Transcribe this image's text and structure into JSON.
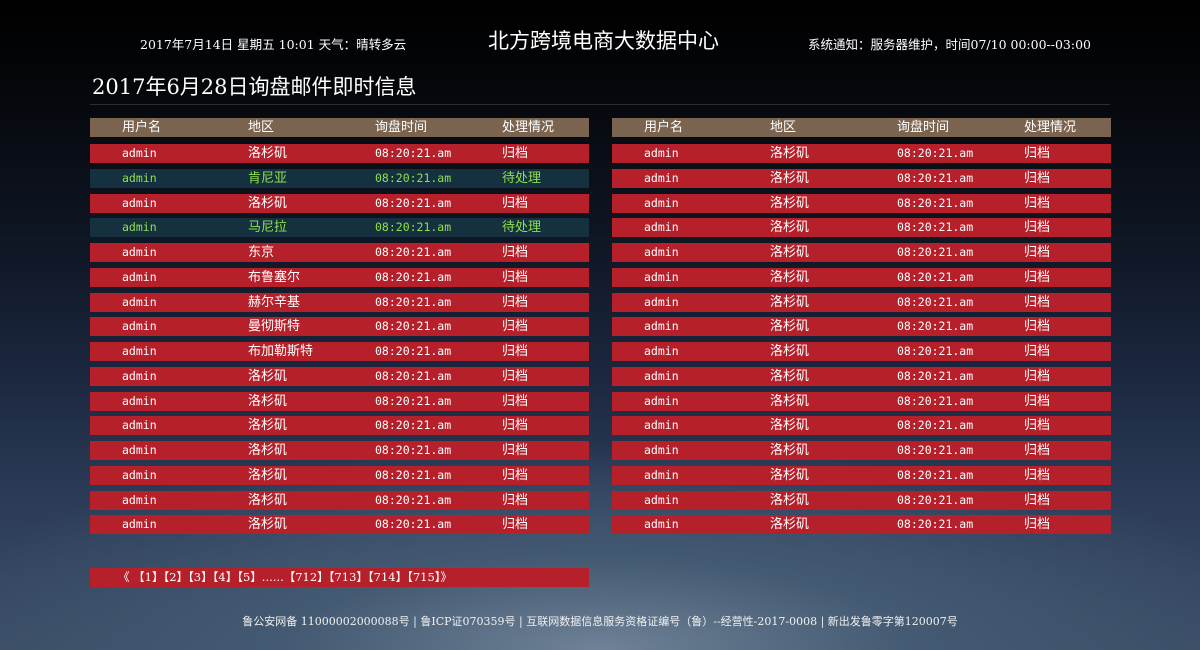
{
  "header": {
    "date_weather": "2017年7月14日  星期五  10:01  天气：晴转多云",
    "site_title": "北方跨境电商大数据中心",
    "notice": "系统通知：服务器维护，时间07/10 00:00--03:00"
  },
  "section_title": "2017年6月28日询盘邮件即时信息",
  "columns": [
    "用户名",
    "地区",
    "询盘时间",
    "处理情况"
  ],
  "left_rows": [
    {
      "user": "admin",
      "region": "洛杉矶",
      "time": "08:20:21.am",
      "status": "归档",
      "kind": "archived"
    },
    {
      "user": "admin",
      "region": "肯尼亚",
      "time": "08:20:21.am",
      "status": "待处理",
      "kind": "pending"
    },
    {
      "user": "admin",
      "region": "洛杉矶",
      "time": "08:20:21.am",
      "status": "归档",
      "kind": "archived"
    },
    {
      "user": "admin",
      "region": "马尼拉",
      "time": "08:20:21.am",
      "status": "待处理",
      "kind": "pending"
    },
    {
      "user": "admin",
      "region": "东京",
      "time": "08:20:21.am",
      "status": "归档",
      "kind": "archived"
    },
    {
      "user": "admin",
      "region": "布鲁塞尔",
      "time": "08:20:21.am",
      "status": "归档",
      "kind": "archived"
    },
    {
      "user": "admin",
      "region": "赫尔辛基",
      "time": "08:20:21.am",
      "status": "归档",
      "kind": "archived"
    },
    {
      "user": "admin",
      "region": "曼彻斯特",
      "time": "08:20:21.am",
      "status": "归档",
      "kind": "archived"
    },
    {
      "user": "admin",
      "region": "布加勒斯特",
      "time": "08:20:21.am",
      "status": "归档",
      "kind": "archived"
    },
    {
      "user": "admin",
      "region": "洛杉矶",
      "time": "08:20:21.am",
      "status": "归档",
      "kind": "archived"
    },
    {
      "user": "admin",
      "region": "洛杉矶",
      "time": "08:20:21.am",
      "status": "归档",
      "kind": "archived"
    },
    {
      "user": "admin",
      "region": "洛杉矶",
      "time": "08:20:21.am",
      "status": "归档",
      "kind": "archived"
    },
    {
      "user": "admin",
      "region": "洛杉矶",
      "time": "08:20:21.am",
      "status": "归档",
      "kind": "archived"
    },
    {
      "user": "admin",
      "region": "洛杉矶",
      "time": "08:20:21.am",
      "status": "归档",
      "kind": "archived"
    },
    {
      "user": "admin",
      "region": "洛杉矶",
      "time": "08:20:21.am",
      "status": "归档",
      "kind": "archived"
    },
    {
      "user": "admin",
      "region": "洛杉矶",
      "time": "08:20:21.am",
      "status": "归档",
      "kind": "archived"
    }
  ],
  "right_rows": [
    {
      "user": "admin",
      "region": "洛杉矶",
      "time": "08:20:21.am",
      "status": "归档",
      "kind": "archived"
    },
    {
      "user": "admin",
      "region": "洛杉矶",
      "time": "08:20:21.am",
      "status": "归档",
      "kind": "archived"
    },
    {
      "user": "admin",
      "region": "洛杉矶",
      "time": "08:20:21.am",
      "status": "归档",
      "kind": "archived"
    },
    {
      "user": "admin",
      "region": "洛杉矶",
      "time": "08:20:21.am",
      "status": "归档",
      "kind": "archived"
    },
    {
      "user": "admin",
      "region": "洛杉矶",
      "time": "08:20:21.am",
      "status": "归档",
      "kind": "archived"
    },
    {
      "user": "admin",
      "region": "洛杉矶",
      "time": "08:20:21.am",
      "status": "归档",
      "kind": "archived"
    },
    {
      "user": "admin",
      "region": "洛杉矶",
      "time": "08:20:21.am",
      "status": "归档",
      "kind": "archived"
    },
    {
      "user": "admin",
      "region": "洛杉矶",
      "time": "08:20:21.am",
      "status": "归档",
      "kind": "archived"
    },
    {
      "user": "admin",
      "region": "洛杉矶",
      "time": "08:20:21.am",
      "status": "归档",
      "kind": "archived"
    },
    {
      "user": "admin",
      "region": "洛杉矶",
      "time": "08:20:21.am",
      "status": "归档",
      "kind": "archived"
    },
    {
      "user": "admin",
      "region": "洛杉矶",
      "time": "08:20:21.am",
      "status": "归档",
      "kind": "archived"
    },
    {
      "user": "admin",
      "region": "洛杉矶",
      "time": "08:20:21.am",
      "status": "归档",
      "kind": "archived"
    },
    {
      "user": "admin",
      "region": "洛杉矶",
      "time": "08:20:21.am",
      "status": "归档",
      "kind": "archived"
    },
    {
      "user": "admin",
      "region": "洛杉矶",
      "time": "08:20:21.am",
      "status": "归档",
      "kind": "archived"
    },
    {
      "user": "admin",
      "region": "洛杉矶",
      "time": "08:20:21.am",
      "status": "归档",
      "kind": "archived"
    },
    {
      "user": "admin",
      "region": "洛杉矶",
      "time": "08:20:21.am",
      "status": "归档",
      "kind": "archived"
    }
  ],
  "pagination": {
    "prev": "《",
    "pages": [
      "【1】",
      "【2】",
      "【3】",
      "【4】",
      "【5】"
    ],
    "ellipsis": "......",
    "tail_pages": [
      "【712】",
      "【713】",
      "【714】",
      "【715】"
    ],
    "next": "》"
  },
  "footer": "鲁公安网备 11000002000088号 | 鲁ICP证070359号 | 互联网数据信息服务资格证编号（鲁）--经营性-2017-0008  | 新出发鲁零字第120007号",
  "colors": {
    "header_row": "#7a6450",
    "archived_row": "#b5202a",
    "pending_row": "#15303e",
    "pending_text": "#8fe04f"
  }
}
